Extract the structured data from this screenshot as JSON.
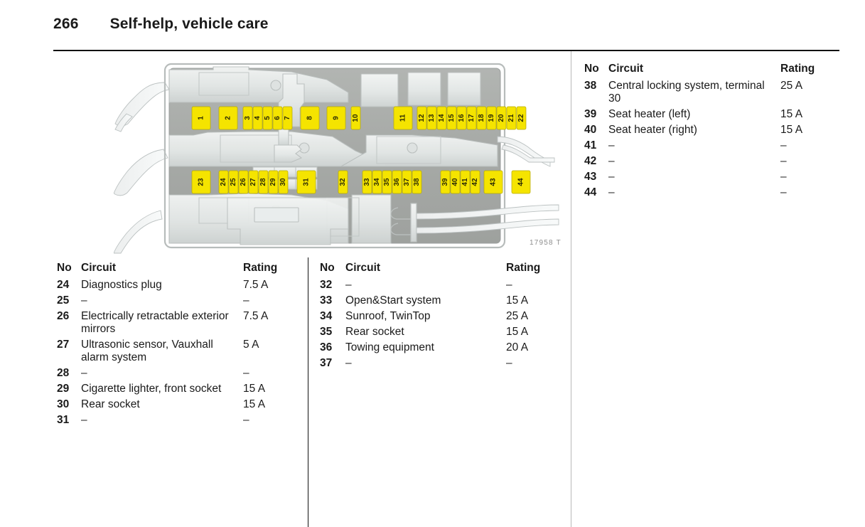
{
  "header": {
    "page_number": "266",
    "title": "Self-help, vehicle care"
  },
  "figure": {
    "caption": "17958 T",
    "fuse_color": "#f5e400",
    "row1": [
      "1",
      "2",
      "3",
      "4",
      "5",
      "6",
      "7",
      "8",
      "9",
      "10",
      "11",
      "12",
      "13",
      "14",
      "15",
      "16",
      "17",
      "18",
      "19",
      "20",
      "21",
      "22"
    ],
    "row2": [
      "23",
      "24",
      "25",
      "26",
      "27",
      "28",
      "29",
      "30",
      "31",
      "32",
      "33",
      "34",
      "35",
      "36",
      "37",
      "38",
      "39",
      "40",
      "41",
      "42",
      "43",
      "44"
    ]
  },
  "tables": {
    "headers": {
      "no": "No",
      "circuit": "Circuit",
      "rating": "Rating"
    },
    "left": [
      {
        "no": "24",
        "circuit": "Diagnostics plug",
        "rating": "7.5 A"
      },
      {
        "no": "25",
        "circuit": "–",
        "rating": "–"
      },
      {
        "no": "26",
        "circuit": "Electrically retractable exterior mirrors",
        "rating": "7.5 A"
      },
      {
        "no": "27",
        "circuit": "Ultrasonic sensor, Vauxhall alarm system",
        "rating": "5 A"
      },
      {
        "no": "28",
        "circuit": "–",
        "rating": "–"
      },
      {
        "no": "29",
        "circuit": "Cigarette lighter, front socket",
        "rating": "15 A"
      },
      {
        "no": "30",
        "circuit": "Rear socket",
        "rating": "15 A"
      },
      {
        "no": "31",
        "circuit": "–",
        "rating": "–"
      }
    ],
    "middle": [
      {
        "no": "32",
        "circuit": "–",
        "rating": "–"
      },
      {
        "no": "33",
        "circuit": "Open&Start system",
        "rating": "15 A"
      },
      {
        "no": "34",
        "circuit": "Sunroof, TwinTop",
        "rating": "25 A"
      },
      {
        "no": "35",
        "circuit": "Rear socket",
        "rating": "15 A"
      },
      {
        "no": "36",
        "circuit": "Towing equipment",
        "rating": "20 A"
      },
      {
        "no": "37",
        "circuit": "–",
        "rating": "–"
      }
    ],
    "right": [
      {
        "no": "38",
        "circuit": "Central locking system, terminal 30",
        "rating": "25 A"
      },
      {
        "no": "39",
        "circuit": "Seat heater (left)",
        "rating": "15 A"
      },
      {
        "no": "40",
        "circuit": "Seat heater (right)",
        "rating": "15 A"
      },
      {
        "no": "41",
        "circuit": "–",
        "rating": "–"
      },
      {
        "no": "42",
        "circuit": "–",
        "rating": "–"
      },
      {
        "no": "43",
        "circuit": "–",
        "rating": "–"
      },
      {
        "no": "44",
        "circuit": "–",
        "rating": "–"
      }
    ]
  }
}
